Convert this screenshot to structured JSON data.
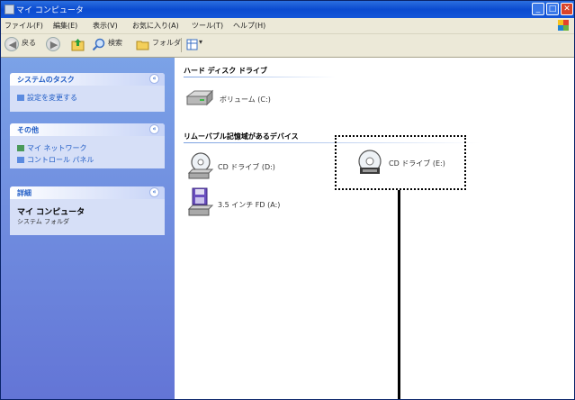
{
  "window": {
    "title": "マイ コンピュータ",
    "buttons": {
      "minimize": "_",
      "maximize": "□",
      "close": "✕"
    }
  },
  "menu": [
    "ファイル(F)",
    "編集(E)",
    "表示(V)",
    "お気に入り(A)",
    "ツール(T)",
    "ヘルプ(H)"
  ],
  "toolbar": {
    "back_label": "戻る",
    "search_label": "検索",
    "folders_label": "フォルダ",
    "view_arrow": "▾"
  },
  "sidebar": {
    "panels": [
      {
        "title": "システムのタスク",
        "items": [
          "設定を変更する"
        ]
      },
      {
        "title": "その他",
        "items": [
          "マイ ネットワーク",
          "コントロール パネル"
        ]
      },
      {
        "title": "詳細",
        "detail_title": "マイ コンピュータ",
        "detail_sub": "システム フォルダ"
      }
    ],
    "collapse_glyph": "«"
  },
  "main": {
    "groups": [
      {
        "header": "ハード ディスク ドライブ",
        "items": [
          {
            "label": "ボリューム (C:)",
            "icon": "hard-disk-icon"
          }
        ]
      },
      {
        "header": "リムーバブル記憶域があるデバイス",
        "items": [
          {
            "label": "CD ドライブ (D:)",
            "icon": "cd-drive-icon"
          },
          {
            "label": "CD ドライブ (E:)",
            "icon": "cd-drive-icon",
            "highlighted": true
          },
          {
            "label": "3.5 インチ FD (A:)",
            "icon": "floppy-drive-icon"
          }
        ]
      }
    ]
  },
  "colors": {
    "titlebar": "#0b4bd0",
    "sidebar": "#6f8fe0",
    "task_link": "#215dc6",
    "menubar": "#ece9d8"
  }
}
